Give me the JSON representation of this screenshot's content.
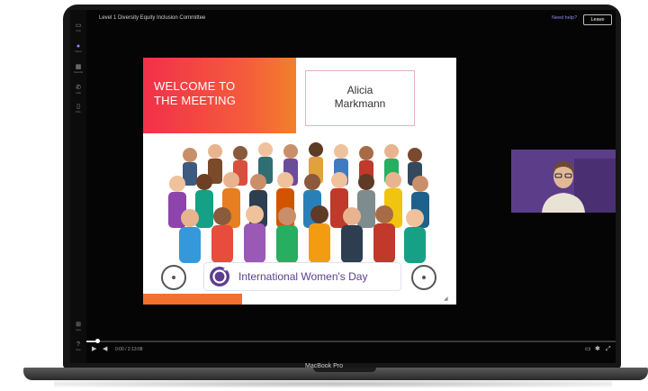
{
  "device": {
    "label": "MacBook Pro"
  },
  "meeting": {
    "title": "Level 1 Diversity Equity Inclusion Committee",
    "need_help": "Need help?",
    "leave": "Leave"
  },
  "rail": [
    {
      "label": "Chat",
      "icon": "chat-icon"
    },
    {
      "label": "Teams",
      "icon": "teams-icon"
    },
    {
      "label": "Calendar",
      "icon": "calendar-icon"
    },
    {
      "label": "Calls",
      "icon": "calls-icon"
    },
    {
      "label": "Files",
      "icon": "files-icon"
    },
    {
      "label": "Apps",
      "icon": "apps-icon"
    },
    {
      "label": "Help",
      "icon": "help-icon"
    }
  ],
  "slide": {
    "title": "WELCOME TO\nTHE MEETING",
    "presenter_name": "Alicia\nMarkmann",
    "banner": "International Women's Day"
  },
  "playback": {
    "time": "0:00 / 2:13:08",
    "progress": 0.02
  },
  "colors": {
    "accent": "#8b8cf5",
    "slide_red": "#f2304a",
    "slide_orange": "#f27030",
    "iwd_purple": "#5b3e8f",
    "video_bg": "#5c3d8a"
  }
}
